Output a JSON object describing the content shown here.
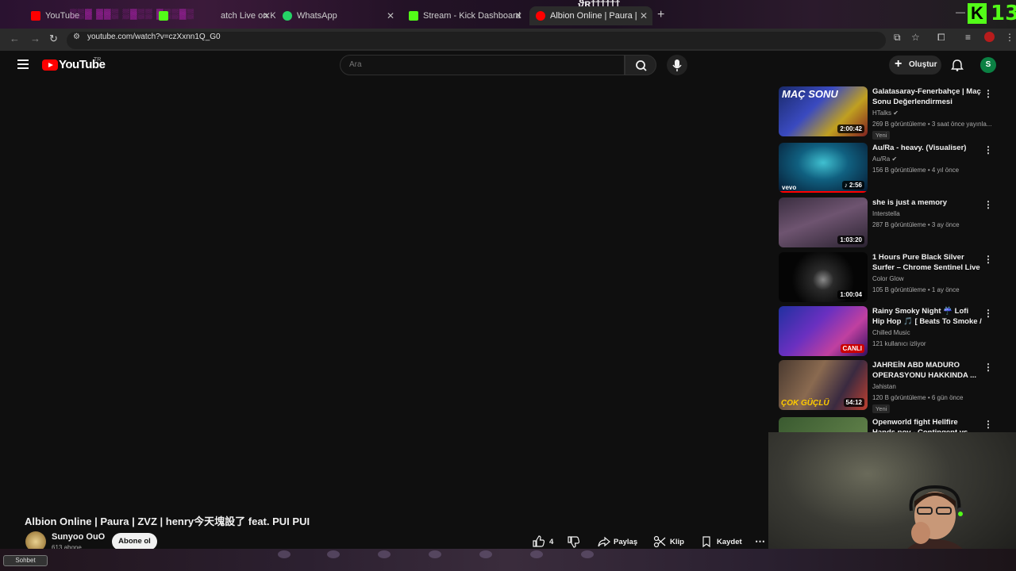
{
  "browser": {
    "tabs": [
      {
        "title": "YouTube",
        "favicon": "youtube-icon",
        "color": "#ff0000"
      },
      {
        "title": "atch Live on K",
        "favicon": "kick-icon",
        "color": "#53fc18"
      },
      {
        "title": "WhatsApp",
        "favicon": "whatsapp-icon",
        "color": "#25d366"
      },
      {
        "title": "Stream - Kick Dashboard",
        "favicon": "kick-icon",
        "color": "#53fc18"
      },
      {
        "title": "Albion Online | Paura | ZVZ | he",
        "favicon": "youtube-icon",
        "color": "#ff0000"
      }
    ],
    "url": "youtube.com/watch?v=czXxnn1Q_G0"
  },
  "stream_overlay": {
    "kick_logo": "K",
    "viewer_count": "13",
    "chat_label": "Sohbet"
  },
  "youtube": {
    "logo_text": "YouTube",
    "country": "TR",
    "search_placeholder": "Ara",
    "create_label": "Oluştur",
    "avatar_letter": "S"
  },
  "recommendations": [
    {
      "title": "Galatasaray-Fenerbahçe | Maç Sonu Değerlendirmesi",
      "channel": "HTalks",
      "verified": true,
      "meta": "269 B görüntüleme • 3 saat önce yayınla...",
      "duration": "2:00:42",
      "badge": "Yeni",
      "thumb_text": "MAÇ SONU"
    },
    {
      "title": "Au/Ra - heavy. (Visualiser)",
      "channel": "Au/Ra",
      "verified": true,
      "meta": "156 B görüntüleme • 4 yıl önce",
      "duration": "♪ 2:56",
      "badge": "",
      "thumb_text": "vevo"
    },
    {
      "title": "she is just a memory",
      "channel": "Interstella",
      "verified": false,
      "meta": "287 B görüntüleme • 3 ay önce",
      "duration": "1:03:20",
      "badge": "",
      "thumb_text": ""
    },
    {
      "title": "1 Hours Pure Black Silver Surfer – Chrome Sentinel Live ...",
      "channel": "Color Glow",
      "verified": false,
      "meta": "105 B görüntüleme • 1 ay önce",
      "duration": "1:00:04",
      "badge": "",
      "thumb_text": ""
    },
    {
      "title": "Rainy Smoky Night ☔ Lofi Hip Hop 🎵 [ Beats To Smoke / Ch...",
      "channel": "Chilled Music",
      "verified": false,
      "meta": "121 kullanıcı izliyor",
      "duration": "CANLI",
      "badge": "",
      "thumb_text": ""
    },
    {
      "title": "JAHREİN ABD MADURO OPERASYONU HAKKINDA ...",
      "channel": "Jahistan",
      "verified": false,
      "meta": "120 B görüntüleme • 6 gün önce",
      "duration": "54:12",
      "badge": "Yeni",
      "thumb_text": "ÇOK GÜÇLÜ"
    },
    {
      "title": "Openworld fight Hellfire Hands pov - Contingent vs Sanctuary",
      "channel": "",
      "verified": false,
      "meta": "",
      "duration": "",
      "badge": "",
      "thumb_text": ""
    }
  ],
  "video": {
    "title": "Albion Online | Paura | ZVZ | henry今天塊設了 feat. PUI PUI",
    "channel": "Sunyoo OuO",
    "subscribers": "613 abone",
    "subscribe_label": "Abone ol",
    "likes": "4",
    "share_label": "Paylaş",
    "clip_label": "Klip",
    "save_label": "Kaydet"
  }
}
